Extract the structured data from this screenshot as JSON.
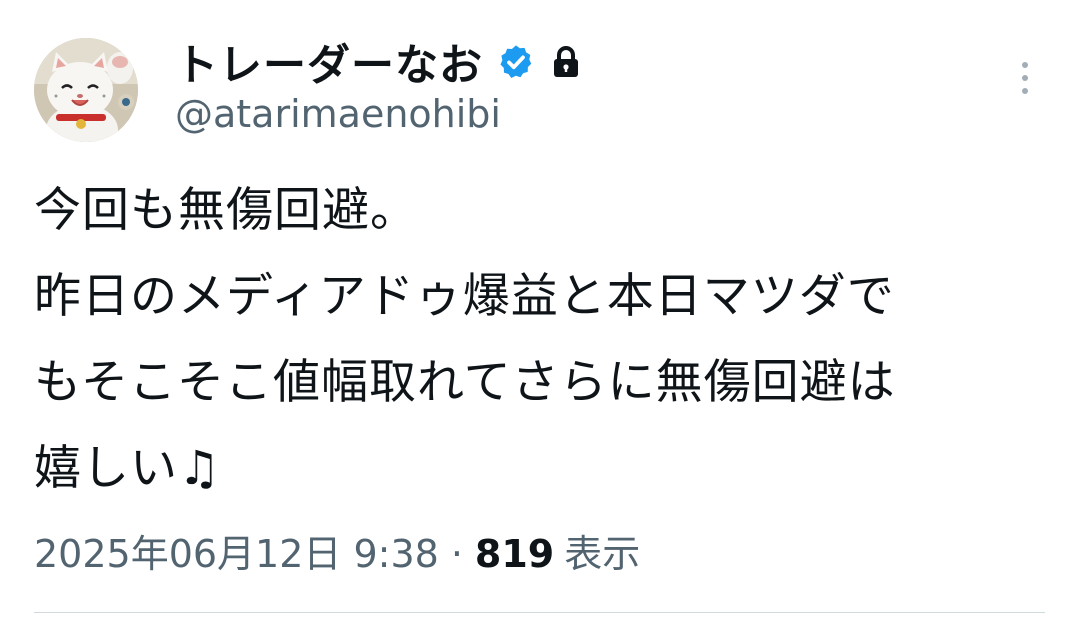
{
  "author": {
    "display_name": "トレーダーなお",
    "handle": "@atarimaenohibi",
    "avatar_icon": "lucky-cat-avatar-icon",
    "verified_icon": "verified-badge-icon",
    "protected_icon": "lock-icon"
  },
  "menu_icon": "more-vertical-icon",
  "body": {
    "lines": [
      "今回も無傷回避。",
      "昨日のメディアドゥ爆益と本日マツダで",
      "もそこそこ値幅取れてさらに無傷回避は",
      "嬉しい♫"
    ]
  },
  "meta": {
    "timestamp": "2025年06月12日 9:38",
    "separator": "·",
    "views_count": "819",
    "views_label": "表示"
  },
  "colors": {
    "text_primary": "#0f1419",
    "text_secondary": "#536471",
    "verified_blue": "#1d9bf0",
    "divider": "#cfd9de"
  }
}
